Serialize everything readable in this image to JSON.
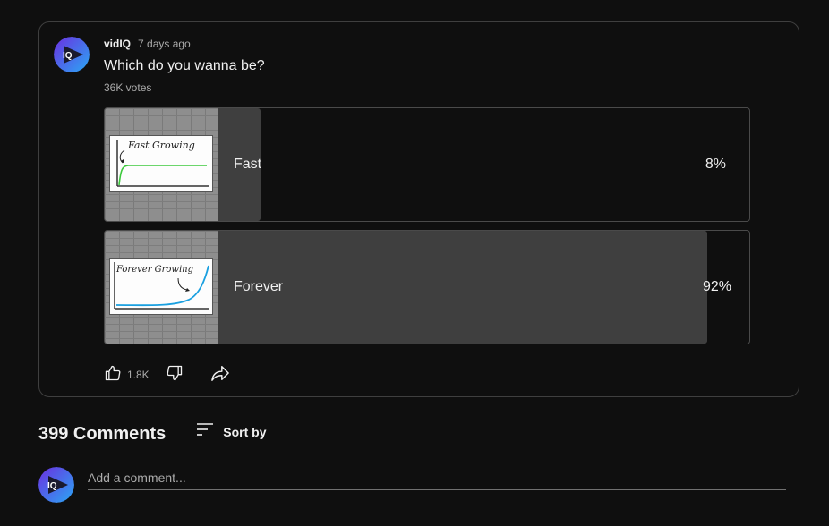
{
  "post": {
    "channel_name": "vidIQ",
    "time": "7 days ago",
    "question": "Which do you wanna be?",
    "votes": "36K votes",
    "avatar_text": "IQ",
    "options": [
      {
        "label": "Fast",
        "percent": "8%",
        "fraction": 0.08,
        "thumb_text": "Fast Growing",
        "thumb_color": "#3cc93c"
      },
      {
        "label": "Forever",
        "percent": "92%",
        "fraction": 0.92,
        "thumb_text": "Forever Growing",
        "thumb_color": "#1aa0e0"
      }
    ],
    "actions": {
      "like_count": "1.8K",
      "like_icon": "thumbs-up-icon",
      "dislike_icon": "thumbs-down-icon",
      "share_icon": "share-icon"
    }
  },
  "comments": {
    "count_label": "399 Comments",
    "sort_label": "Sort by",
    "sort_icon": "sort-icon",
    "input_placeholder": "Add a comment...",
    "avatar_text": "IQ"
  },
  "colors": {
    "background": "#0f0f0f",
    "bar_fill": "#3f3f3f",
    "brand_gradient_start": "#5a3be8",
    "brand_gradient_end": "#2fb5f0"
  }
}
